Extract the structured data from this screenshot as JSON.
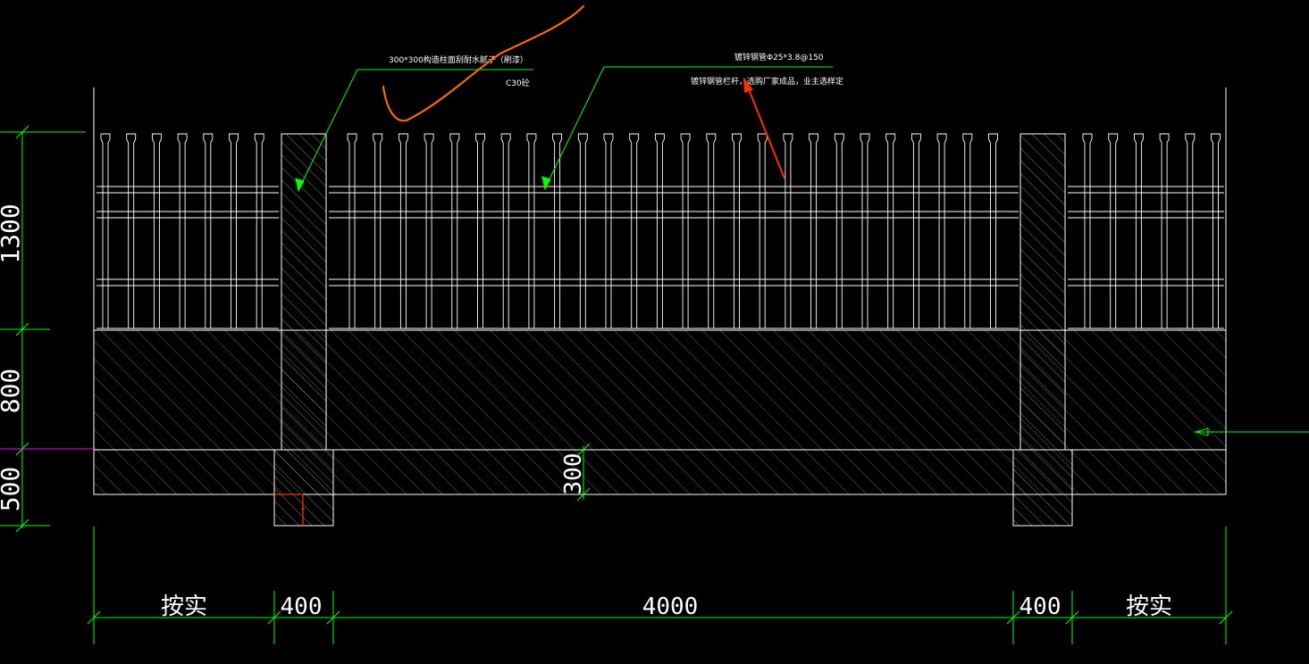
{
  "drawing": {
    "horizontal_dims": [
      "按实",
      "400",
      "4000",
      "400",
      "按实"
    ],
    "vertical_dims": [
      "1300",
      "800",
      "500"
    ],
    "footing_dim": "300",
    "annotations": {
      "column_note": "300*300构造柱面刮耐水腻子（刷漆）",
      "concrete_grade": "C30砼",
      "rail_pipe": "镀锌钢管Φ25*3.8@150",
      "rail_note": "镀锌钢管栏杆，选购厂家成品，业主选样定"
    },
    "colors": {
      "background": "#000000",
      "lines": "#ffffff",
      "dimension": "#00ff00",
      "leader": "#00ff00",
      "markup_orange": "#ff6a00",
      "markup_red": "#ff2a00",
      "datum": "#ff00ff"
    }
  }
}
